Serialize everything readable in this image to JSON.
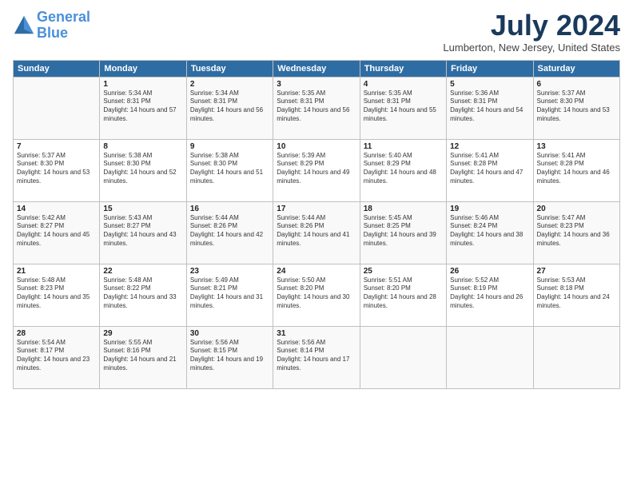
{
  "header": {
    "logo_line1": "General",
    "logo_line2": "Blue",
    "month_title": "July 2024",
    "subtitle": "Lumberton, New Jersey, United States"
  },
  "days_of_week": [
    "Sunday",
    "Monday",
    "Tuesday",
    "Wednesday",
    "Thursday",
    "Friday",
    "Saturday"
  ],
  "weeks": [
    [
      {
        "day": "",
        "sunrise": "",
        "sunset": "",
        "daylight": ""
      },
      {
        "day": "1",
        "sunrise": "Sunrise: 5:34 AM",
        "sunset": "Sunset: 8:31 PM",
        "daylight": "Daylight: 14 hours and 57 minutes."
      },
      {
        "day": "2",
        "sunrise": "Sunrise: 5:34 AM",
        "sunset": "Sunset: 8:31 PM",
        "daylight": "Daylight: 14 hours and 56 minutes."
      },
      {
        "day": "3",
        "sunrise": "Sunrise: 5:35 AM",
        "sunset": "Sunset: 8:31 PM",
        "daylight": "Daylight: 14 hours and 56 minutes."
      },
      {
        "day": "4",
        "sunrise": "Sunrise: 5:35 AM",
        "sunset": "Sunset: 8:31 PM",
        "daylight": "Daylight: 14 hours and 55 minutes."
      },
      {
        "day": "5",
        "sunrise": "Sunrise: 5:36 AM",
        "sunset": "Sunset: 8:31 PM",
        "daylight": "Daylight: 14 hours and 54 minutes."
      },
      {
        "day": "6",
        "sunrise": "Sunrise: 5:37 AM",
        "sunset": "Sunset: 8:30 PM",
        "daylight": "Daylight: 14 hours and 53 minutes."
      }
    ],
    [
      {
        "day": "7",
        "sunrise": "Sunrise: 5:37 AM",
        "sunset": "Sunset: 8:30 PM",
        "daylight": "Daylight: 14 hours and 53 minutes."
      },
      {
        "day": "8",
        "sunrise": "Sunrise: 5:38 AM",
        "sunset": "Sunset: 8:30 PM",
        "daylight": "Daylight: 14 hours and 52 minutes."
      },
      {
        "day": "9",
        "sunrise": "Sunrise: 5:38 AM",
        "sunset": "Sunset: 8:30 PM",
        "daylight": "Daylight: 14 hours and 51 minutes."
      },
      {
        "day": "10",
        "sunrise": "Sunrise: 5:39 AM",
        "sunset": "Sunset: 8:29 PM",
        "daylight": "Daylight: 14 hours and 49 minutes."
      },
      {
        "day": "11",
        "sunrise": "Sunrise: 5:40 AM",
        "sunset": "Sunset: 8:29 PM",
        "daylight": "Daylight: 14 hours and 48 minutes."
      },
      {
        "day": "12",
        "sunrise": "Sunrise: 5:41 AM",
        "sunset": "Sunset: 8:28 PM",
        "daylight": "Daylight: 14 hours and 47 minutes."
      },
      {
        "day": "13",
        "sunrise": "Sunrise: 5:41 AM",
        "sunset": "Sunset: 8:28 PM",
        "daylight": "Daylight: 14 hours and 46 minutes."
      }
    ],
    [
      {
        "day": "14",
        "sunrise": "Sunrise: 5:42 AM",
        "sunset": "Sunset: 8:27 PM",
        "daylight": "Daylight: 14 hours and 45 minutes."
      },
      {
        "day": "15",
        "sunrise": "Sunrise: 5:43 AM",
        "sunset": "Sunset: 8:27 PM",
        "daylight": "Daylight: 14 hours and 43 minutes."
      },
      {
        "day": "16",
        "sunrise": "Sunrise: 5:44 AM",
        "sunset": "Sunset: 8:26 PM",
        "daylight": "Daylight: 14 hours and 42 minutes."
      },
      {
        "day": "17",
        "sunrise": "Sunrise: 5:44 AM",
        "sunset": "Sunset: 8:26 PM",
        "daylight": "Daylight: 14 hours and 41 minutes."
      },
      {
        "day": "18",
        "sunrise": "Sunrise: 5:45 AM",
        "sunset": "Sunset: 8:25 PM",
        "daylight": "Daylight: 14 hours and 39 minutes."
      },
      {
        "day": "19",
        "sunrise": "Sunrise: 5:46 AM",
        "sunset": "Sunset: 8:24 PM",
        "daylight": "Daylight: 14 hours and 38 minutes."
      },
      {
        "day": "20",
        "sunrise": "Sunrise: 5:47 AM",
        "sunset": "Sunset: 8:23 PM",
        "daylight": "Daylight: 14 hours and 36 minutes."
      }
    ],
    [
      {
        "day": "21",
        "sunrise": "Sunrise: 5:48 AM",
        "sunset": "Sunset: 8:23 PM",
        "daylight": "Daylight: 14 hours and 35 minutes."
      },
      {
        "day": "22",
        "sunrise": "Sunrise: 5:48 AM",
        "sunset": "Sunset: 8:22 PM",
        "daylight": "Daylight: 14 hours and 33 minutes."
      },
      {
        "day": "23",
        "sunrise": "Sunrise: 5:49 AM",
        "sunset": "Sunset: 8:21 PM",
        "daylight": "Daylight: 14 hours and 31 minutes."
      },
      {
        "day": "24",
        "sunrise": "Sunrise: 5:50 AM",
        "sunset": "Sunset: 8:20 PM",
        "daylight": "Daylight: 14 hours and 30 minutes."
      },
      {
        "day": "25",
        "sunrise": "Sunrise: 5:51 AM",
        "sunset": "Sunset: 8:20 PM",
        "daylight": "Daylight: 14 hours and 28 minutes."
      },
      {
        "day": "26",
        "sunrise": "Sunrise: 5:52 AM",
        "sunset": "Sunset: 8:19 PM",
        "daylight": "Daylight: 14 hours and 26 minutes."
      },
      {
        "day": "27",
        "sunrise": "Sunrise: 5:53 AM",
        "sunset": "Sunset: 8:18 PM",
        "daylight": "Daylight: 14 hours and 24 minutes."
      }
    ],
    [
      {
        "day": "28",
        "sunrise": "Sunrise: 5:54 AM",
        "sunset": "Sunset: 8:17 PM",
        "daylight": "Daylight: 14 hours and 23 minutes."
      },
      {
        "day": "29",
        "sunrise": "Sunrise: 5:55 AM",
        "sunset": "Sunset: 8:16 PM",
        "daylight": "Daylight: 14 hours and 21 minutes."
      },
      {
        "day": "30",
        "sunrise": "Sunrise: 5:56 AM",
        "sunset": "Sunset: 8:15 PM",
        "daylight": "Daylight: 14 hours and 19 minutes."
      },
      {
        "day": "31",
        "sunrise": "Sunrise: 5:56 AM",
        "sunset": "Sunset: 8:14 PM",
        "daylight": "Daylight: 14 hours and 17 minutes."
      },
      {
        "day": "",
        "sunrise": "",
        "sunset": "",
        "daylight": ""
      },
      {
        "day": "",
        "sunrise": "",
        "sunset": "",
        "daylight": ""
      },
      {
        "day": "",
        "sunrise": "",
        "sunset": "",
        "daylight": ""
      }
    ]
  ]
}
